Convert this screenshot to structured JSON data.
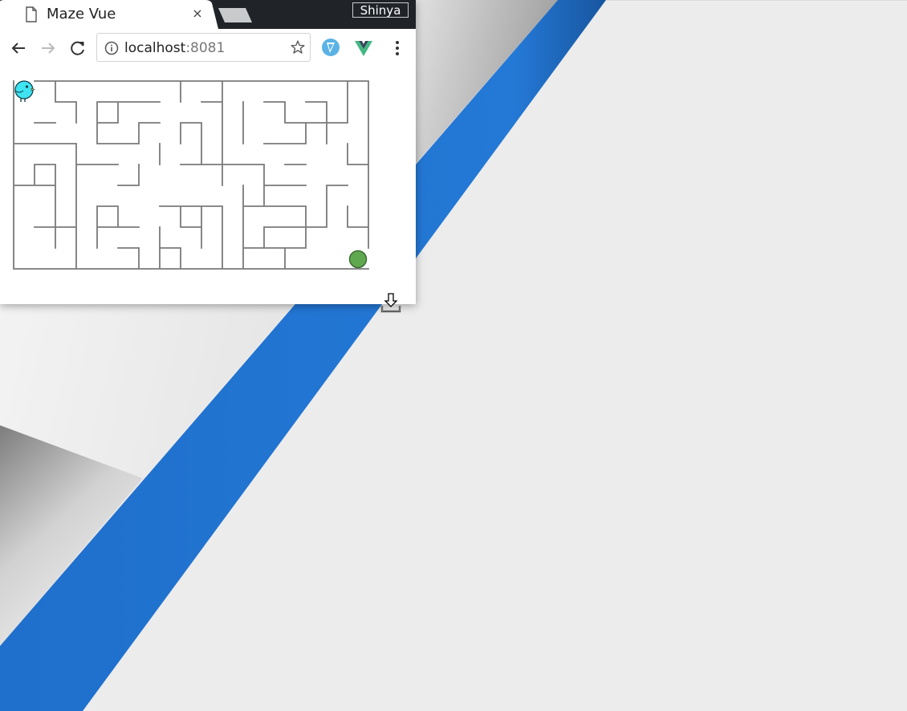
{
  "browser": {
    "tab": {
      "title": "Maze Vue",
      "close_glyph": "×",
      "icon": "page-icon"
    },
    "profile_name": "Shinya",
    "toolbar": {
      "back_icon": "back-arrow-icon",
      "forward_icon": "forward-arrow-icon",
      "reload_icon": "reload-icon",
      "url_host": "localhost",
      "url_port": ":8081",
      "bookmark_icon": "star-icon",
      "extensions": [
        "vue-devtools-extension-icon",
        "vue-logo-extension-icon"
      ],
      "menu_icon": "kebab-menu-icon"
    }
  },
  "maze": {
    "columns": 17,
    "rows": 9,
    "player": "bird-icon",
    "goal": "green-circle-goal",
    "colors": {
      "wall": "#7a7a7a",
      "goal_fill": "#5fa84f",
      "player": "#3fe3f2"
    }
  },
  "desktop": {
    "colors": {
      "background": "#ececec",
      "stripe": "#2377d4"
    },
    "cursor": "download-cursor-icon"
  }
}
